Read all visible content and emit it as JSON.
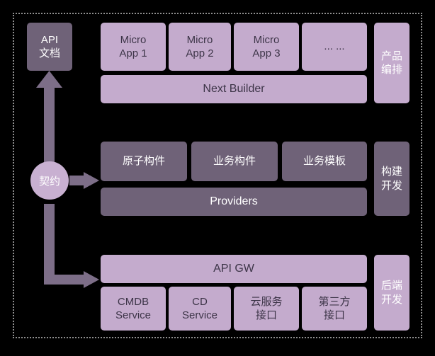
{
  "diagram": {
    "title": "Architecture layers diagram",
    "colors": {
      "background": "#000000",
      "light_box": "#c4abcd",
      "dark_box": "#6f6278",
      "circle": "#c8b0d1",
      "arrow": "#7d6e88",
      "frame_border": "#8f8f8f",
      "dark_text": "#3d3548",
      "light_text": "#ffffff"
    },
    "left_column": {
      "api_doc_label": "API\n文档",
      "contract_label": "契约"
    },
    "rows": [
      {
        "id": "product-row",
        "side_label": "产品\n编排",
        "top_items": [
          "Micro\nApp 1",
          "Micro\nApp 2",
          "Micro\nApp 3",
          "... ..."
        ],
        "bottom_bar": "Next Builder"
      },
      {
        "id": "build-row",
        "side_label": "构建\n开发",
        "top_items": [
          "原子构件",
          "业务构件",
          "业务模板"
        ],
        "bottom_bar": "Providers"
      },
      {
        "id": "backend-row",
        "side_label": "后端\n开发",
        "top_bar": "API GW",
        "bottom_items": [
          "CMDB\nService",
          "CD\nService",
          "云服务\n接口",
          "第三方\n接口"
        ]
      }
    ]
  }
}
